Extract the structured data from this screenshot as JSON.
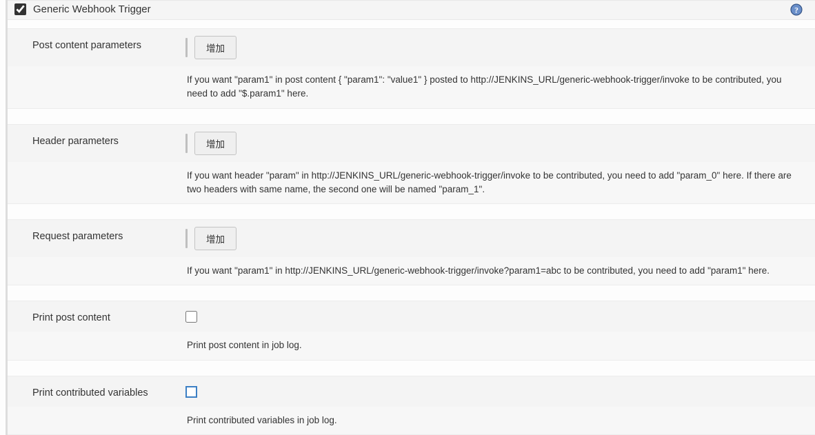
{
  "header": {
    "title": "Generic Webhook Trigger",
    "checked": true
  },
  "sections": {
    "postContent": {
      "label": "Post content parameters",
      "buttonLabel": "增加",
      "description": "If you want \"param1\" in post content { \"param1\": \"value1\" } posted to http://JENKINS_URL/generic-webhook-trigger/invoke to be contributed, you need to add \"$.param1\" here."
    },
    "headerParams": {
      "label": "Header parameters",
      "buttonLabel": "增加",
      "description": "If you want header \"param\" in http://JENKINS_URL/generic-webhook-trigger/invoke to be contributed, you need to add \"param_0\" here. If there are two headers with same name, the second one will be named \"param_1\"."
    },
    "requestParams": {
      "label": "Request parameters",
      "buttonLabel": "增加",
      "description": "If you want \"param1\" in http://JENKINS_URL/generic-webhook-trigger/invoke?param1=abc to be contributed, you need to add \"param1\" here."
    },
    "printPost": {
      "label": "Print post content",
      "description": "Print post content in job log."
    },
    "printVars": {
      "label": "Print contributed variables",
      "description": "Print contributed variables in job log."
    }
  }
}
